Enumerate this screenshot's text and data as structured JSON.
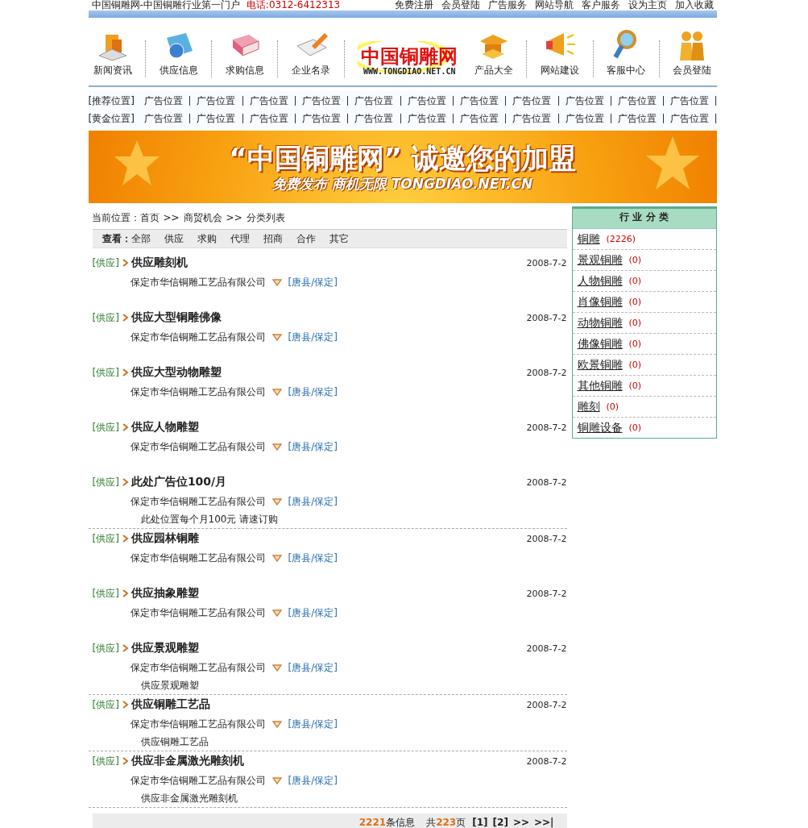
{
  "top_bar": {
    "site_title": "中国铜雕网-中国铜雕行业第一门户",
    "phone": "电话:0312-6412313",
    "links": [
      "免费注册",
      "会员登陆",
      "广告服务",
      "网站导航",
      "客户服务",
      "设为主页",
      "加入收藏"
    ]
  },
  "nav": {
    "left": [
      "新闻资讯",
      "供应信息",
      "求购信息",
      "企业名录"
    ],
    "logo": {
      "name": "中国铜雕网",
      "url": "WWW.TONGDIAO.NET.CN"
    },
    "right": [
      "产品大全",
      "网站建设",
      "客服中心",
      "会员登陆"
    ]
  },
  "ad_rows": [
    {
      "label": "[推荐位置]",
      "slots": [
        "广告位置",
        "广告位置",
        "广告位置",
        "广告位置",
        "广告位置",
        "广告位置",
        "广告位置",
        "广告位置",
        "广告位置",
        "广告位置",
        "广告位置"
      ]
    },
    {
      "label": "[黄金位置]",
      "slots": [
        "广告位置",
        "广告位置",
        "广告位置",
        "广告位置",
        "广告位置",
        "广告位置",
        "广告位置",
        "广告位置",
        "广告位置",
        "广告位置",
        "广告位置"
      ]
    }
  ],
  "banner": {
    "title": "“中国铜雕网” 诚邀您的加盟",
    "subtitle": "免费发布 商机无限 TONGDIAO.NET.CN"
  },
  "breadcrumb": {
    "label": "当前位置：",
    "separator": ">>",
    "items": [
      "首页",
      "商贸机会",
      "分类列表"
    ]
  },
  "filter": {
    "label": "查看：",
    "options": [
      "全部",
      "供应",
      "求购",
      "代理",
      "招商",
      "合作",
      "其它"
    ]
  },
  "listings": [
    {
      "tag": "[供应]",
      "title": "供应雕刻机",
      "date": "2008-7-2",
      "company": "保定市华信铜雕工艺品有限公司",
      "location": "[唐县/保定]"
    },
    {
      "tag": "[供应]",
      "title": "供应大型铜雕佛像",
      "date": "2008-7-2",
      "company": "保定市华信铜雕工艺品有限公司",
      "location": "[唐县/保定]"
    },
    {
      "tag": "[供应]",
      "title": "供应大型动物雕塑",
      "date": "2008-7-2",
      "company": "保定市华信铜雕工艺品有限公司",
      "location": "[唐县/保定]"
    },
    {
      "tag": "[供应]",
      "title": "供应人物雕塑",
      "date": "2008-7-2",
      "company": "保定市华信铜雕工艺品有限公司",
      "location": "[唐县/保定]"
    },
    {
      "tag": "[供应]",
      "title": "此处广告位100/月",
      "date": "2008-7-2",
      "company": "保定市华信铜雕工艺品有限公司",
      "location": "[唐县/保定]",
      "description": "此处位置每个月100元 请速订购"
    },
    {
      "tag": "[供应]",
      "title": "供应园林铜雕",
      "date": "2008-7-2",
      "company": "保定市华信铜雕工艺品有限公司",
      "location": "[唐县/保定]"
    },
    {
      "tag": "[供应]",
      "title": "供应抽象雕塑",
      "date": "2008-7-2",
      "company": "保定市华信铜雕工艺品有限公司",
      "location": "[唐县/保定]"
    },
    {
      "tag": "[供应]",
      "title": "供应景观雕塑",
      "date": "2008-7-2",
      "company": "保定市华信铜雕工艺品有限公司",
      "location": "[唐县/保定]",
      "description": "供应景观雕塑"
    },
    {
      "tag": "[供应]",
      "title": "供应铜雕工艺品",
      "date": "2008-7-2",
      "company": "保定市华信铜雕工艺品有限公司",
      "location": "[唐县/保定]",
      "description": "供应铜雕工艺品"
    },
    {
      "tag": "[供应]",
      "title": "供应非金属激光雕刻机",
      "date": "2008-7-2",
      "company": "保定市华信铜雕工艺品有限公司",
      "location": "[唐县/保定]",
      "description": "供应非金属激光雕刻机"
    }
  ],
  "pagination": {
    "total": "2221",
    "total_suffix": "条信息",
    "pages_prefix": "共",
    "pages": "223",
    "pages_suffix": "页",
    "links": [
      "[1]",
      "[2]",
      ">>",
      ">>|"
    ]
  },
  "sidebar": {
    "title": "行 业 分 类",
    "categories": [
      {
        "name": "铜雕",
        "count": "(2226)"
      },
      {
        "name": "景观铜雕",
        "count": "(0)"
      },
      {
        "name": "人物铜雕",
        "count": "(0)"
      },
      {
        "name": "肖像铜雕",
        "count": "(0)"
      },
      {
        "name": "动物铜雕",
        "count": "(0)"
      },
      {
        "name": "佛像铜雕",
        "count": "(0)"
      },
      {
        "name": "欧景铜雕",
        "count": "(0)"
      },
      {
        "name": "其他铜雕",
        "count": "(0)"
      },
      {
        "name": "雕刻",
        "count": "(0)"
      },
      {
        "name": "铜雕设备",
        "count": "(0)"
      }
    ]
  }
}
